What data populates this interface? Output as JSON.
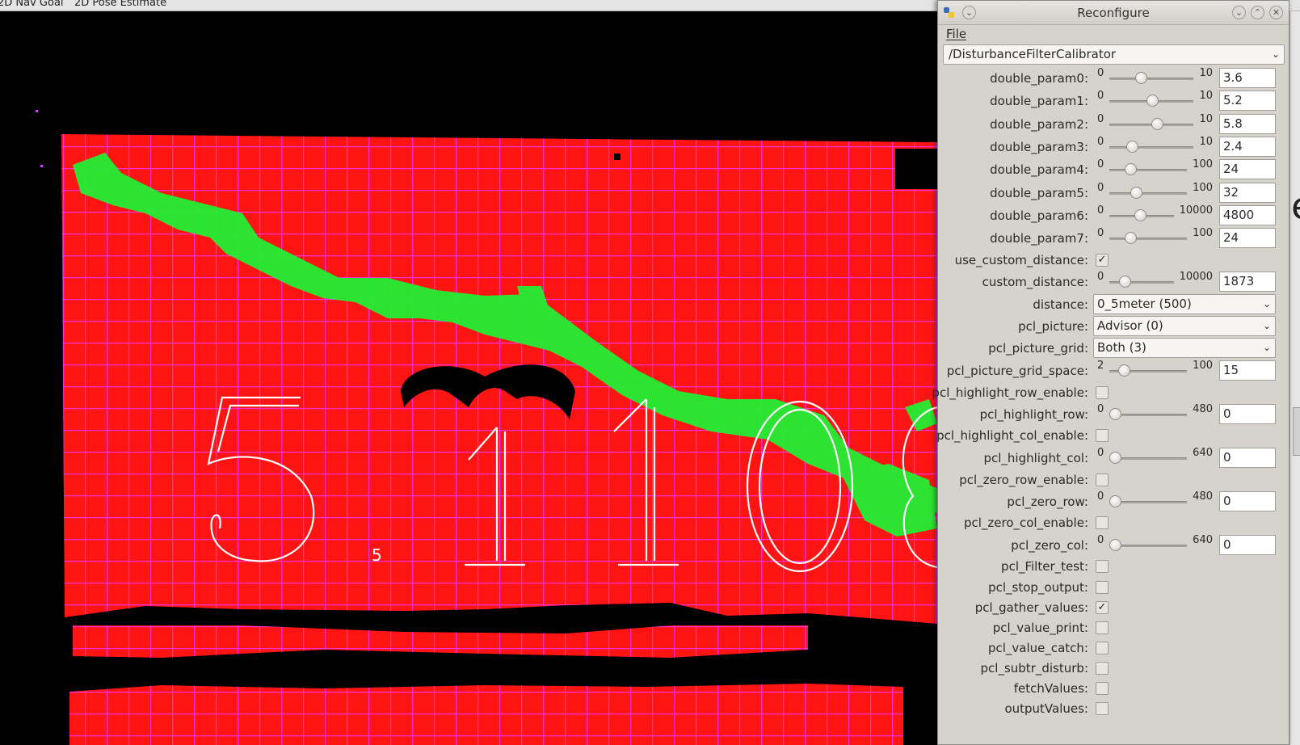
{
  "rviz": {
    "toolbar": {
      "nav_goal": "2D Nav Goal",
      "pose_estimate": "2D Pose Estimate"
    },
    "overlay_text": {
      "d1": "5",
      "d2": "1",
      "d3": "1",
      "d4": "0"
    },
    "colors": {
      "background": "#000000",
      "cloud": "#ff1414",
      "grid": "#ff2fd6",
      "disturbance": "#22ee33",
      "overlay": "#ffffff"
    }
  },
  "edge": {
    "glyph": "e"
  },
  "reconfigure": {
    "title": "Reconfigure",
    "menu_file": "File",
    "node": "/DisturbanceFilterCalibrator",
    "params": [
      {
        "type": "slider",
        "name": "double_param0:",
        "min": "0",
        "max": "10",
        "value": "3.6",
        "frac": 0.36
      },
      {
        "type": "slider",
        "name": "double_param1:",
        "min": "0",
        "max": "10",
        "value": "5.2",
        "frac": 0.52
      },
      {
        "type": "slider",
        "name": "double_param2:",
        "min": "0",
        "max": "10",
        "value": "5.8",
        "frac": 0.58
      },
      {
        "type": "slider",
        "name": "double_param3:",
        "min": "0",
        "max": "10",
        "value": "2.4",
        "frac": 0.24
      },
      {
        "type": "slider",
        "name": "double_param4:",
        "min": "0",
        "max": "100",
        "value": "24",
        "frac": 0.24
      },
      {
        "type": "slider",
        "name": "double_param5:",
        "min": "0",
        "max": "100",
        "value": "32",
        "frac": 0.32
      },
      {
        "type": "slider",
        "name": "double_param6:",
        "min": "0",
        "max": "10000",
        "value": "4800",
        "frac": 0.48
      },
      {
        "type": "slider",
        "name": "double_param7:",
        "min": "0",
        "max": "100",
        "value": "24",
        "frac": 0.24
      },
      {
        "type": "check",
        "name": "use_custom_distance:",
        "checked": true
      },
      {
        "type": "slider",
        "name": "custom_distance:",
        "min": "0",
        "max": "10000",
        "value": "1873",
        "frac": 0.1873
      },
      {
        "type": "select",
        "name": "distance:",
        "value": "0_5meter (500)"
      },
      {
        "type": "select",
        "name": "pcl_picture:",
        "value": "Advisor (0)"
      },
      {
        "type": "select",
        "name": "pcl_picture_grid:",
        "value": "Both (3)"
      },
      {
        "type": "slider",
        "name": "pcl_picture_grid_space:",
        "min": "2",
        "max": "100",
        "value": "15",
        "frac": 0.133
      },
      {
        "type": "check",
        "name": "pcl_highlight_row_enable:",
        "checked": false
      },
      {
        "type": "slider",
        "name": "pcl_highlight_row:",
        "min": "0",
        "max": "480",
        "value": "0",
        "frac": 0
      },
      {
        "type": "check",
        "name": "pcl_highlight_col_enable:",
        "checked": false
      },
      {
        "type": "slider",
        "name": "pcl_highlight_col:",
        "min": "0",
        "max": "640",
        "value": "0",
        "frac": 0
      },
      {
        "type": "check",
        "name": "pcl_zero_row_enable:",
        "checked": false
      },
      {
        "type": "slider",
        "name": "pcl_zero_row:",
        "min": "0",
        "max": "480",
        "value": "0",
        "frac": 0
      },
      {
        "type": "check",
        "name": "pcl_zero_col_enable:",
        "checked": false
      },
      {
        "type": "slider",
        "name": "pcl_zero_col:",
        "min": "0",
        "max": "640",
        "value": "0",
        "frac": 0
      },
      {
        "type": "check",
        "name": "pcl_Filter_test:",
        "checked": false
      },
      {
        "type": "check",
        "name": "pcl_stop_output:",
        "checked": false
      },
      {
        "type": "check",
        "name": "pcl_gather_values:",
        "checked": true
      },
      {
        "type": "check",
        "name": "pcl_value_print:",
        "checked": false
      },
      {
        "type": "check",
        "name": "pcl_value_catch:",
        "checked": false
      },
      {
        "type": "check",
        "name": "pcl_subtr_disturb:",
        "checked": false
      },
      {
        "type": "check",
        "name": "fetchValues:",
        "checked": false
      },
      {
        "type": "check",
        "name": "outputValues:",
        "checked": false
      }
    ]
  }
}
